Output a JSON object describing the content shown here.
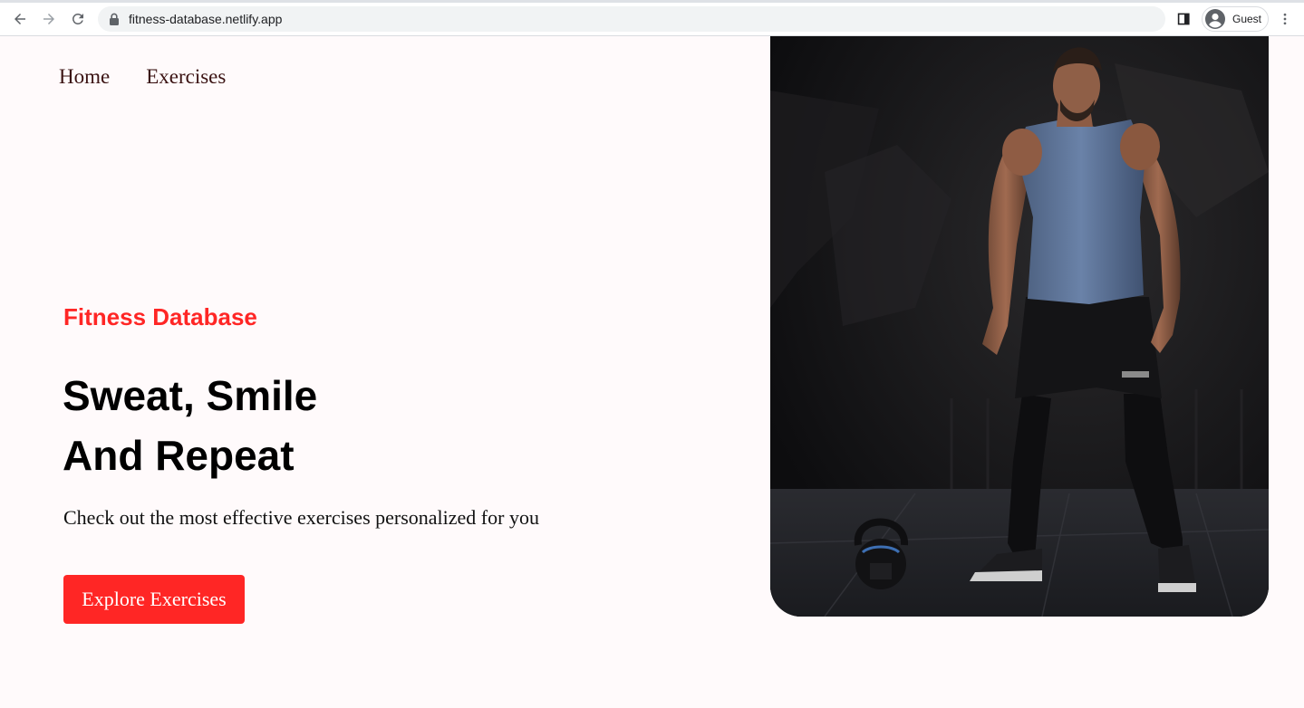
{
  "browser": {
    "url": "fitness-database.netlify.app",
    "profile_label": "Guest"
  },
  "nav": {
    "items": [
      "Home",
      "Exercises"
    ]
  },
  "hero": {
    "brand": "Fitness Database",
    "headline_line1": "Sweat, Smile",
    "headline_line2": "And Repeat",
    "subtext": "Check out the most effective exercises personalized for you",
    "cta_label": "Explore Exercises",
    "image_subject": "athlete with kettlebell"
  },
  "colors": {
    "accent": "#ff2625",
    "background": "#fffafb",
    "nav_text": "#3a1212"
  }
}
